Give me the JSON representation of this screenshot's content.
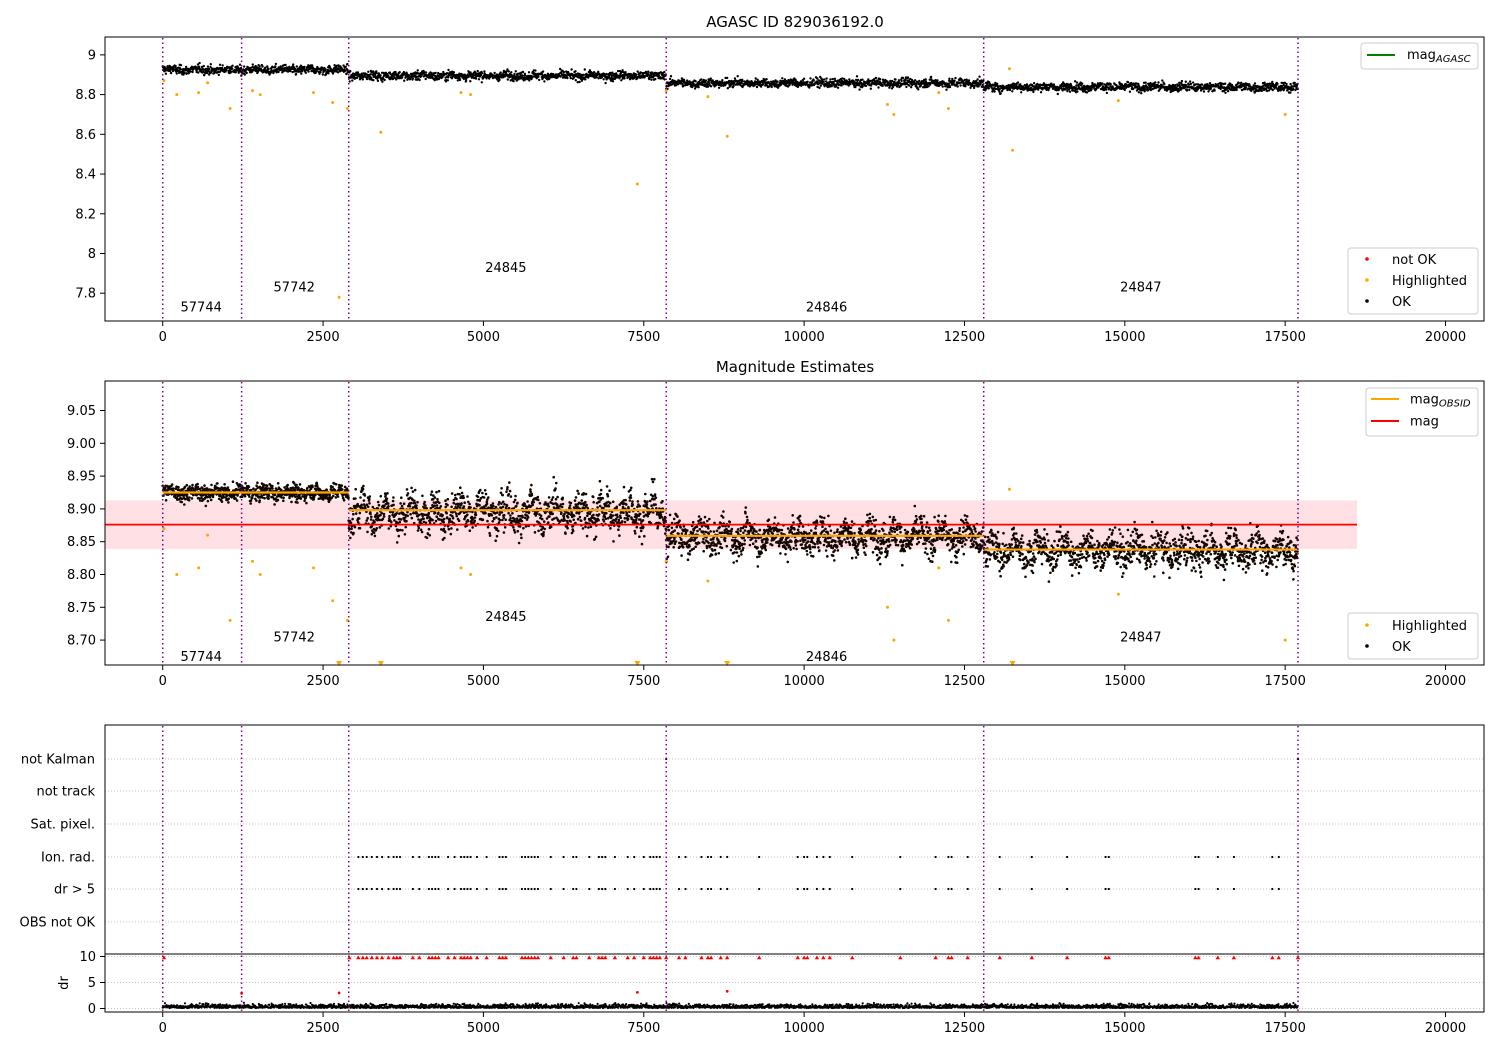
{
  "chart_data": [
    {
      "type": "scatter",
      "title": "AGASC ID 829036192.0",
      "xlim": [
        -900,
        20600
      ],
      "ylim": [
        7.66,
        9.09
      ],
      "yticks": [
        7.8,
        8.0,
        8.2,
        8.4,
        8.6,
        8.8,
        9.0
      ],
      "xticks": [
        0,
        2500,
        5000,
        7500,
        10000,
        12500,
        15000,
        17500,
        20000
      ],
      "grid": false,
      "observation_boundaries": [
        0,
        1230,
        2900,
        7850,
        12800,
        17700
      ],
      "observations": [
        {
          "label": "57744",
          "x_range": [
            0,
            1230
          ],
          "label_x": 600,
          "label_y": 7.73,
          "mean": 8.925
        },
        {
          "label": "57742",
          "x_range": [
            1230,
            2900
          ],
          "label_x": 2050,
          "label_y": 7.83,
          "mean": 8.925
        },
        {
          "label": "24845",
          "x_range": [
            2900,
            7850
          ],
          "label_x": 5350,
          "label_y": 7.93,
          "mean": 8.895
        },
        {
          "label": "24846",
          "x_range": [
            7850,
            12800
          ],
          "label_x": 10350,
          "label_y": 7.73,
          "mean": 8.858
        },
        {
          "label": "24847",
          "x_range": [
            12800,
            17700
          ],
          "label_x": 15250,
          "label_y": 7.83,
          "mean": 8.838
        }
      ],
      "highlighted_outliers": [
        [
          20,
          8.87
        ],
        [
          220,
          8.8
        ],
        [
          560,
          8.81
        ],
        [
          700,
          8.86
        ],
        [
          1050,
          8.73
        ],
        [
          1400,
          8.82
        ],
        [
          1520,
          8.8
        ],
        [
          2350,
          8.81
        ],
        [
          2650,
          8.76
        ],
        [
          2750,
          7.78
        ],
        [
          2880,
          8.73
        ],
        [
          3400,
          8.61
        ],
        [
          4650,
          8.81
        ],
        [
          4800,
          8.8
        ],
        [
          7400,
          8.35
        ],
        [
          7850,
          8.82
        ],
        [
          8500,
          8.79
        ],
        [
          8800,
          8.59
        ],
        [
          11300,
          8.75
        ],
        [
          11400,
          8.7
        ],
        [
          12100,
          8.81
        ],
        [
          12250,
          8.73
        ],
        [
          13200,
          8.93
        ],
        [
          13250,
          8.52
        ],
        [
          14900,
          8.77
        ],
        [
          17500,
          8.7
        ]
      ],
      "legend_top": {
        "placement": "top-right",
        "entries": [
          {
            "label": "mag",
            "subscript": "AGASC",
            "color": "#008000"
          }
        ]
      },
      "legend_bottom": {
        "placement": "lower-right",
        "entries": [
          {
            "label": "not OK",
            "color": "#ff0000"
          },
          {
            "label": "Highlighted",
            "color": "#ffa500"
          },
          {
            "label": "OK",
            "color": "#000000"
          }
        ]
      }
    },
    {
      "type": "scatter",
      "title": "Magnitude Estimates",
      "xlim": [
        -900,
        20600
      ],
      "ylim": [
        8.662,
        9.095
      ],
      "yticks": [
        8.7,
        8.75,
        8.8,
        8.85,
        8.9,
        8.95,
        9.0,
        9.05
      ],
      "ytick_labels": [
        "8.70",
        "8.75",
        "8.80",
        "8.85",
        "8.90",
        "8.95",
        "9.00",
        "9.05"
      ],
      "xticks": [
        0,
        2500,
        5000,
        7500,
        10000,
        12500,
        15000,
        17500,
        20000
      ],
      "grid": false,
      "mag": 8.876,
      "mag_band": [
        8.839,
        8.913
      ],
      "mag_line_x": [
        -900,
        18620
      ],
      "observation_labels": [
        {
          "label": "57744",
          "x": 600,
          "y": 8.675
        },
        {
          "label": "57742",
          "x": 2050,
          "y": 8.705
        },
        {
          "label": "24845",
          "x": 5350,
          "y": 8.736
        },
        {
          "label": "24846",
          "x": 10350,
          "y": 8.675
        },
        {
          "label": "24847",
          "x": 15250,
          "y": 8.705
        }
      ],
      "observation_means": [
        {
          "x_range": [
            0,
            2900
          ],
          "mean": 8.925
        },
        {
          "x_range": [
            2900,
            7850
          ],
          "mean": 8.898
        },
        {
          "x_range": [
            7850,
            12800
          ],
          "mean": 8.859
        },
        {
          "x_range": [
            12800,
            17700
          ],
          "mean": 8.838
        }
      ],
      "below_range_markers": [
        2750,
        3400,
        7400,
        8800,
        13250
      ],
      "legend_top": {
        "placement": "top-right",
        "entries": [
          {
            "label": "mag",
            "subscript": "OBSID",
            "color": "#ffa500"
          },
          {
            "label": "mag",
            "subscript": "",
            "color": "#ff0000"
          }
        ]
      },
      "legend_bottom": {
        "placement": "lower-right",
        "entries": [
          {
            "label": "Highlighted",
            "color": "#ffa500"
          },
          {
            "label": "OK",
            "color": "#000000"
          }
        ]
      }
    },
    {
      "type": "scatter",
      "title": "",
      "xlim": [
        -900,
        20600
      ],
      "xticks": [
        0,
        2500,
        5000,
        7500,
        10000,
        12500,
        15000,
        17500,
        20000
      ],
      "flag_categories": [
        "not Kalman",
        "not track",
        "Sat. pixel.",
        "Ion. rad.",
        "dr > 5",
        "OBS not OK"
      ],
      "flag_events": [
        3050,
        3120,
        3180,
        3260,
        3340,
        3420,
        3520,
        3600,
        3650,
        3700,
        3900,
        4000,
        4150,
        4200,
        4250,
        4300,
        4450,
        4550,
        4650,
        4700,
        4750,
        4800,
        4900,
        5050,
        5250,
        5300,
        5350,
        5600,
        5650,
        5700,
        5750,
        5800,
        5850,
        6050,
        6250,
        6400,
        6450,
        6650,
        6800,
        6850,
        6900,
        7050,
        7250,
        7350,
        7500,
        7600,
        7650,
        7700,
        7750,
        8050,
        8150,
        8400,
        8500,
        8550,
        8700,
        8800,
        9300,
        9900,
        10000,
        10050,
        10200,
        10300,
        10400,
        10750,
        11500,
        12050,
        12250,
        12300,
        12550,
        13050,
        13550,
        14100,
        14700,
        14750,
        16100,
        16150,
        16450,
        16700,
        17300,
        17400
      ],
      "dr_ylabel": "dr",
      "dr_yticks": [
        0,
        5,
        10
      ],
      "dr_ylim": [
        -1,
        10.5
      ],
      "dr_clip": 10
    }
  ],
  "colors": {
    "ok": "#000000",
    "highlighted": "#ffa500",
    "not_ok": "#ff0000",
    "mag": "#ff0000",
    "band": "#ffe0e4",
    "obsid_mean": "#ffa500",
    "agasc": "#008000",
    "boundary": "#800080",
    "grid": "#b0b0b0"
  }
}
